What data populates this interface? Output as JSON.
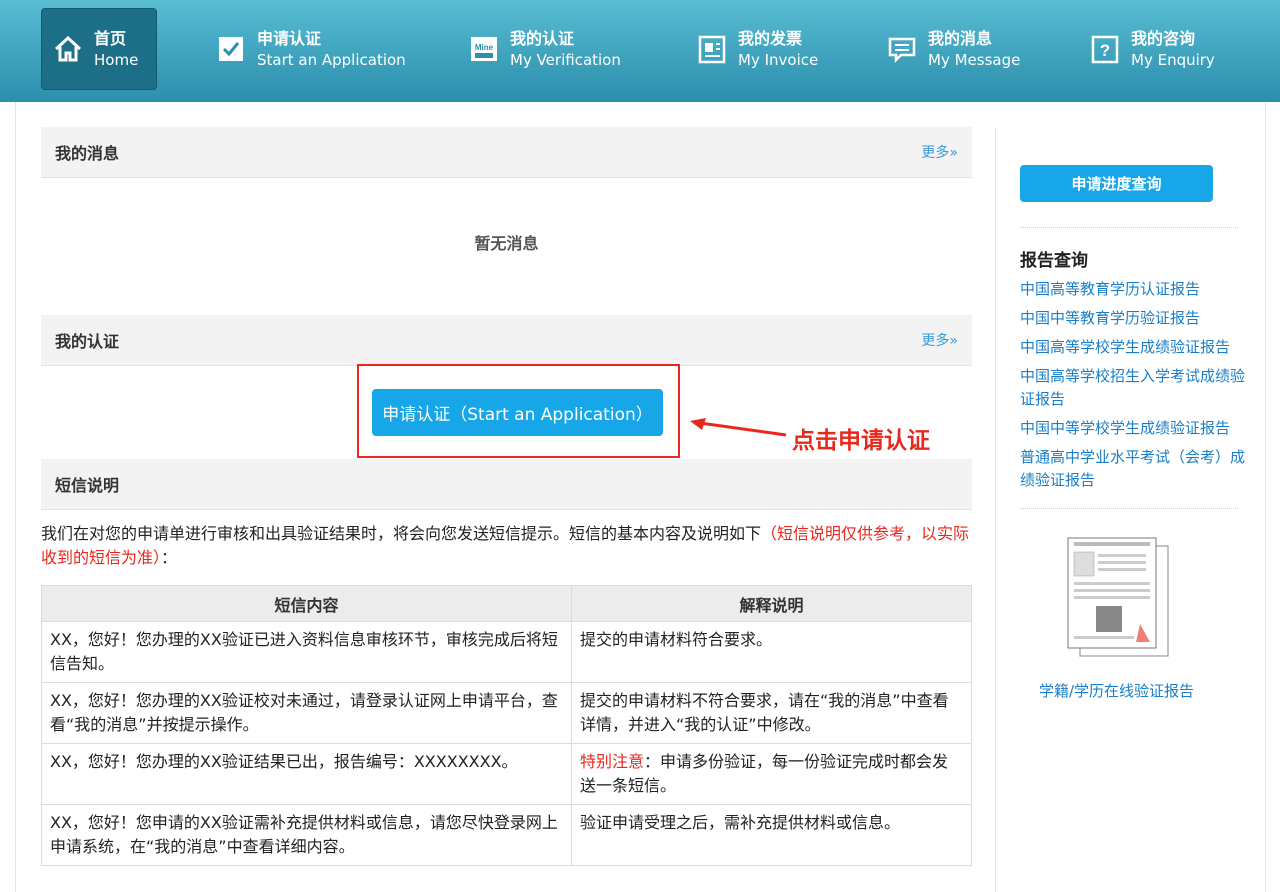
{
  "nav": {
    "items": [
      {
        "zh": "首页",
        "en": "Home",
        "icon": "home-icon"
      },
      {
        "zh": "申请认证",
        "en": "Start an Application",
        "icon": "checkbox-icon"
      },
      {
        "zh": "我的认证",
        "en": "My Verification",
        "icon": "mine-icon"
      },
      {
        "zh": "我的发票",
        "en": "My Invoice",
        "icon": "invoice-icon"
      },
      {
        "zh": "我的消息",
        "en": "My Message",
        "icon": "message-icon"
      },
      {
        "zh": "我的咨询",
        "en": "My Enquiry",
        "icon": "question-icon"
      }
    ]
  },
  "messages": {
    "title": "我的消息",
    "more": "更多»",
    "empty": "暂无消息"
  },
  "verification": {
    "title": "我的认证",
    "more": "更多»",
    "apply_button": "申请认证（Start an Application）",
    "annotation": "点击申请认证"
  },
  "sms": {
    "title": "短信说明",
    "desc_main": "我们在对您的申请单进行审核和出具验证结果时，将会向您发送短信提示。短信的基本内容及说明如下",
    "desc_note": "（短信说明仅供参考，以实际收到的短信为准）",
    "desc_end": "：",
    "headers": [
      "短信内容",
      "解释说明"
    ],
    "rows": [
      {
        "content": "XX，您好！您办理的XX验证已进入资料信息审核环节，审核完成后将短信告知。",
        "note_prefix": "",
        "note": "提交的申请材料符合要求。"
      },
      {
        "content": "XX，您好！您办理的XX验证校对未通过，请登录认证网上申请平台，查看“我的消息”并按提示操作。",
        "note_prefix": "",
        "note": "提交的申请材料不符合要求，请在“我的消息”中查看详情，并进入“我的认证”中修改。"
      },
      {
        "content": "XX，您好！您办理的XX验证结果已出，报告编号：XXXXXXXX。",
        "note_prefix": "特别注意",
        "note": "：申请多份验证，每一份验证完成时都会发送一条短信。"
      },
      {
        "content": "XX，您好！您申请的XX验证需补充提供材料或信息，请您尽快登录网上申请系统，在“我的消息”中查看详细内容。",
        "note_prefix": "",
        "note": "验证申请受理之后，需补充提供材料或信息。"
      }
    ]
  },
  "sidebar": {
    "progress_button": "申请进度查询",
    "report_title": "报告查询",
    "report_links": [
      "中国高等教育学历认证报告",
      "中国中等教育学历验证报告",
      "中国高等学校学生成绩验证报告",
      "中国高等学校招生入学考试成绩验证报告",
      "中国中等学校学生成绩验证报告",
      "普通高中学业水平考试（会考）成绩验证报告"
    ],
    "thumb_caption": "学籍/学历在线验证报告"
  },
  "colors": {
    "nav_top": "#58bcd3",
    "nav_bottom": "#2b8fad",
    "accent": "#17a6e8",
    "annotation": "#e8281d",
    "link": "#1a7fc8"
  }
}
